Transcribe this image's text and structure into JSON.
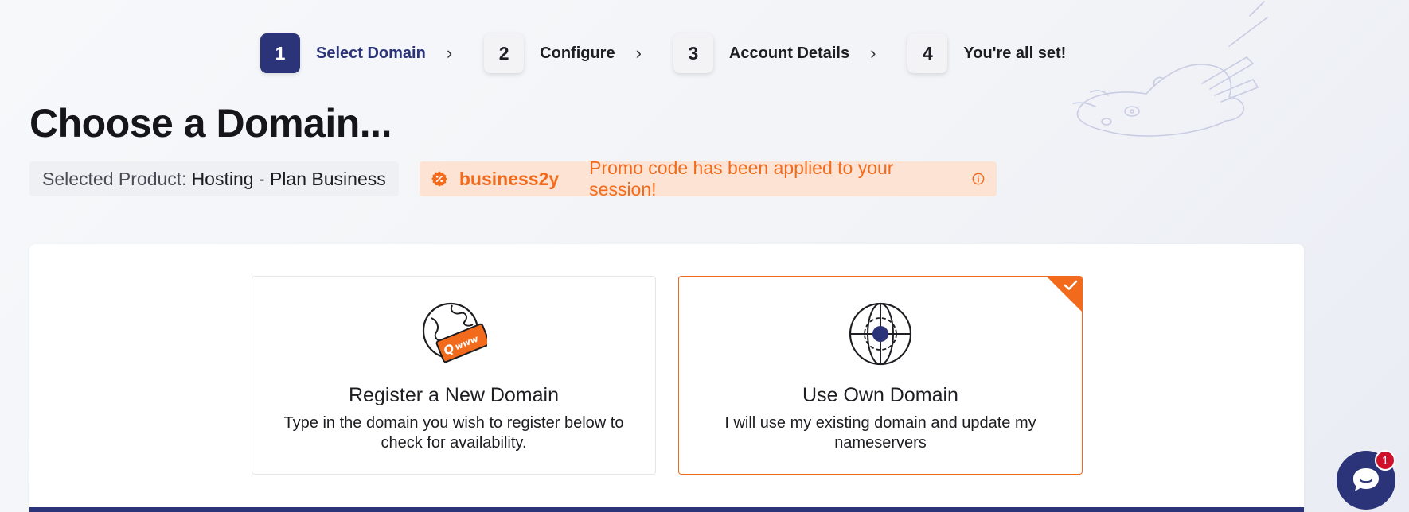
{
  "stepper": {
    "steps": [
      {
        "number": "1",
        "label": "Select Domain"
      },
      {
        "number": "2",
        "label": "Configure"
      },
      {
        "number": "3",
        "label": "Account Details"
      },
      {
        "number": "4",
        "label": "You're all set!"
      }
    ],
    "separator": "›",
    "active_step": 1
  },
  "page": {
    "title": "Choose a Domain..."
  },
  "product": {
    "label": "Selected Product:",
    "value": "Hosting - Plan Business"
  },
  "promo": {
    "icon": "badge-percent-icon",
    "code": "business2y",
    "message": "Promo code has been applied to your session!",
    "info_icon": "info-icon"
  },
  "options": [
    {
      "icon": "globe-www-icon",
      "title": "Register a New Domain",
      "description": "Type in the domain you wish to register below to check for availability.",
      "selected": false
    },
    {
      "icon": "globe-target-icon",
      "title": "Use Own Domain",
      "description": "I will use my existing domain and update my nameservers",
      "selected": true
    }
  ],
  "chat": {
    "icon": "chat-icon",
    "badge_count": "1"
  },
  "colors": {
    "brand": "#2b3479",
    "accent": "#f26b1d",
    "promo_bg": "#fde3d3",
    "badge": "#d0112b"
  }
}
